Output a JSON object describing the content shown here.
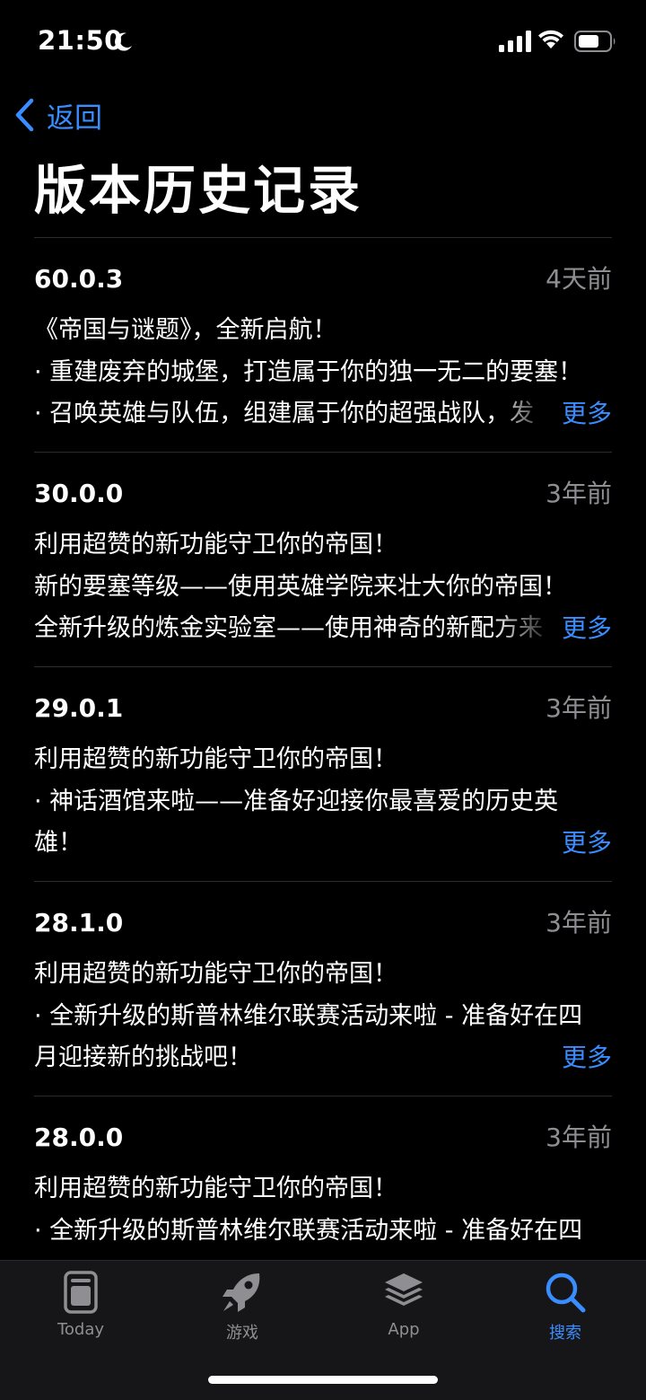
{
  "status_bar": {
    "time": "21:50"
  },
  "nav": {
    "back_label": "返回",
    "title": "版本历史记录"
  },
  "colors": {
    "accent": "#3a8dff",
    "secondary_text": "#8e8e93",
    "background": "#000000"
  },
  "versions": [
    {
      "version": "60.0.3",
      "date": "4天前",
      "lines": [
        "《帝国与谜题》，全新启航！",
        "· 重建废弃的城堡，打造属于你的独一无二的要塞！",
        "· 召唤英雄与队伍，组建属于你的超强战队，发"
      ],
      "more": "更多"
    },
    {
      "version": "30.0.0",
      "date": "3年前",
      "lines": [
        "利用超赞的新功能守卫你的帝国！",
        "新的要塞等级——使用英雄学院来壮大你的帝国！",
        "全新升级的炼金实验室——使用神奇的新配方来"
      ],
      "more": "更多"
    },
    {
      "version": "29.0.1",
      "date": "3年前",
      "lines": [
        "利用超赞的新功能守卫你的帝国！",
        "· 神话酒馆来啦——准备好迎接你最喜爱的历史英",
        "雄！"
      ],
      "more": "更多"
    },
    {
      "version": "28.1.0",
      "date": "3年前",
      "lines": [
        "利用超赞的新功能守卫你的帝国！",
        "· 全新升级的斯普林维尔联赛活动来啦 - 准备好在四",
        "月迎接新的挑战吧！"
      ],
      "more": "更多"
    },
    {
      "version": "28.0.0",
      "date": "3年前",
      "lines": [
        "利用超赞的新功能守卫你的帝国！",
        "· 全新升级的斯普林维尔联赛活动来啦 - 准备好在四"
      ]
    }
  ],
  "tab_bar": {
    "tabs": [
      {
        "label": "Today",
        "icon": "today-icon",
        "active": false
      },
      {
        "label": "游戏",
        "icon": "rocket-icon",
        "active": false
      },
      {
        "label": "App",
        "icon": "app-stack-icon",
        "active": false
      },
      {
        "label": "搜索",
        "icon": "search-icon",
        "active": true
      }
    ]
  }
}
